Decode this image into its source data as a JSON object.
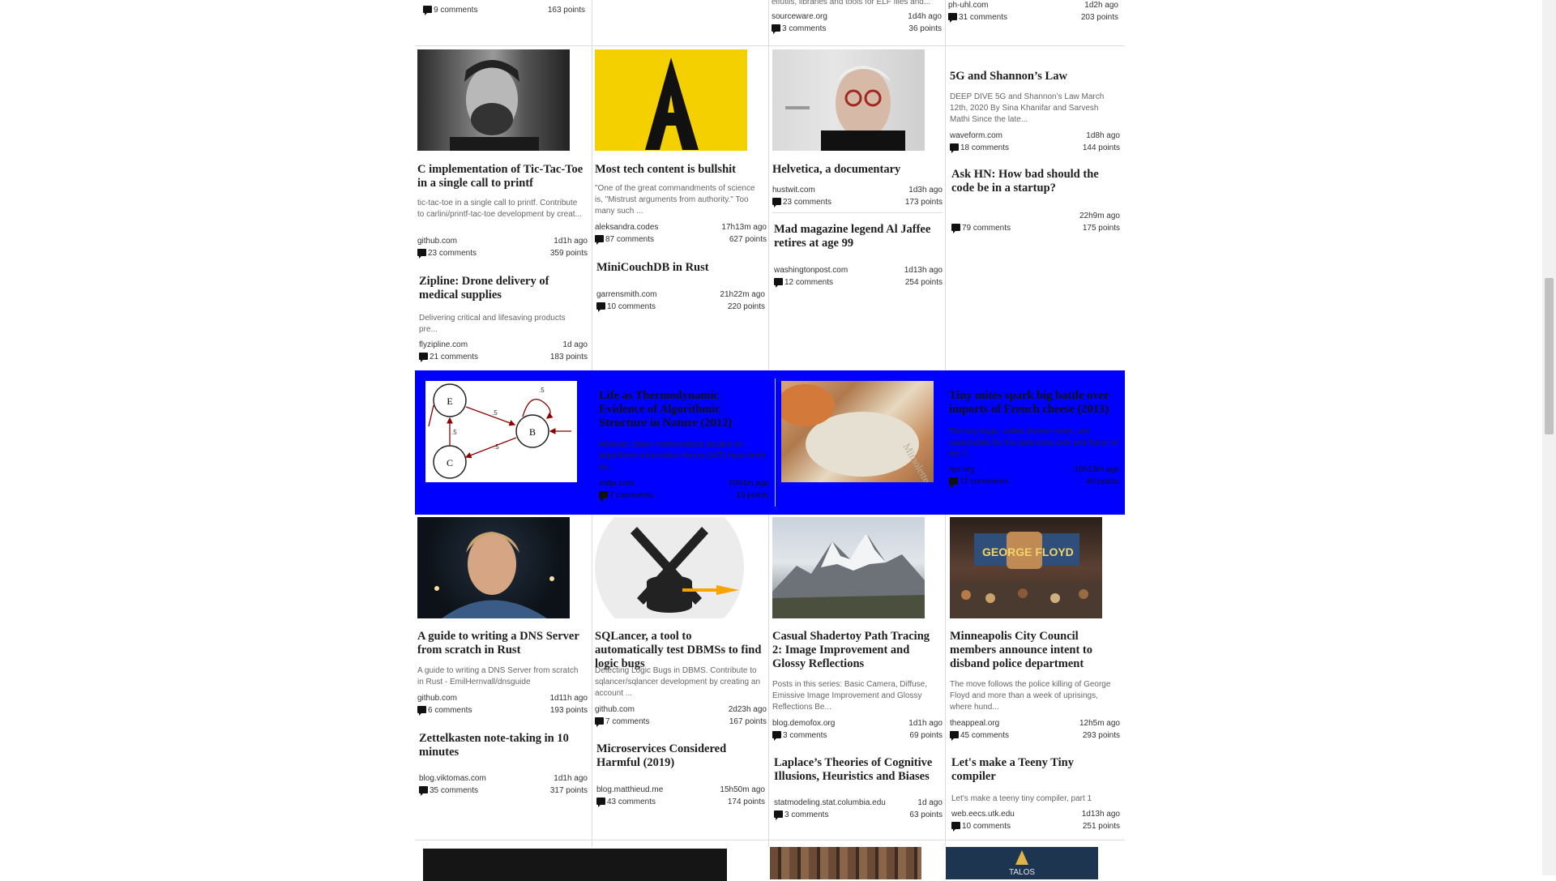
{
  "top_partial": {
    "col1": {
      "comments": "9 comments",
      "points": "163 points"
    },
    "col3": {
      "snippet": "elfutils, libraries and tools for ELF files and...",
      "domain": "sourceware.org",
      "age": "1d4h ago",
      "comments": "3 comments",
      "points": "36 points"
    },
    "col4": {
      "domain": "ph-uhl.com",
      "age": "1d2h ago",
      "comments": "31 comments",
      "points": "203 points"
    }
  },
  "articles": {
    "tictactoe": {
      "title": "C implementation of Tic-Tac-Toe in a single call to printf",
      "snippet": "tic-tac-toe in a single call to printf. Contribute to carlini/printf-tac-toe development by creat...",
      "domain": "github.com",
      "age": "1d1h ago",
      "comments": "23 comments",
      "points": "359 points"
    },
    "zipline": {
      "title": "Zipline: Drone delivery of medical supplies",
      "snippet": "Delivering critical and lifesaving products pre...",
      "domain": "flyzipline.com",
      "age": "1d ago",
      "comments": "21 comments",
      "points": "183 points"
    },
    "bullshit": {
      "title": "Most tech content is bullshit",
      "snippet": "\"One of the great commandments of science is, \"Mistrust arguments from authority.\" Too many such ...",
      "domain": "aleksandra.codes",
      "age": "17h13m ago",
      "comments": "87 comments",
      "points": "627 points"
    },
    "minicouch": {
      "title": "MiniCouchDB in Rust",
      "domain": "garrensmith.com",
      "age": "21h22m ago",
      "comments": "10 comments",
      "points": "220 points"
    },
    "helvetica": {
      "title": "Helvetica, a documentary",
      "domain": "hustwit.com",
      "age": "1d3h ago",
      "comments": "23 comments",
      "points": "173 points"
    },
    "jaffee": {
      "title": "Mad magazine legend Al Jaffee retires at age 99",
      "domain": "washingtonpost.com",
      "age": "1d13h ago",
      "comments": "12 comments",
      "points": "254 points"
    },
    "fiveg": {
      "title": "5G and Shannon’s Law",
      "snippet": "DEEP DIVE 5G and Shannon’s Law March 12th, 2020 By Sina Khanifar and Sarvesh Mathi Since the late...",
      "domain": "waveform.com",
      "age": "1d8h ago",
      "comments": "18 comments",
      "points": "144 points"
    },
    "askhn": {
      "title": "Ask HN: How bad should the code be in a startup?",
      "age": "22h9m ago",
      "comments": "79 comments",
      "points": "175 points"
    },
    "thermo": {
      "title": "Life as Thermodynamic Evidence of Algorithmic Structure in Nature (2012)",
      "snippet": "Abstract: Many mathematical studies on algorithmic information theory (AIT) have been on...",
      "domain": "mdpi.com",
      "age": "10h4m ago",
      "comments": "7 comments",
      "points": "19 points"
    },
    "cheese": {
      "title": "Tiny mites spark big battle over imports of French cheese (2013)",
      "snippet": "The tiny bugs, called cheese mites, are responsible for the distinctive look and flavor of the F...",
      "domain": "npr.org",
      "age": "10h13m ago",
      "comments": "12 comments",
      "points": "40 points"
    },
    "dns": {
      "title": "A guide to writing a DNS Server from scratch in Rust",
      "snippet": "A guide to writing a DNS Server from scratch in Rust - EmilHernvall/dnsguide",
      "domain": "github.com",
      "age": "1d11h ago",
      "comments": "6 comments",
      "points": "193 points"
    },
    "zettel": {
      "title": "Zettelkasten note-taking in 10 minutes",
      "domain": "blog.viktomas.com",
      "age": "1d1h ago",
      "comments": "35 comments",
      "points": "317 points"
    },
    "sqlancer": {
      "title": "SQLancer, a tool to automatically test DBMSs to find logic bugs",
      "snippet": "Detecting Logic Bugs in DBMS. Contribute to sqlancer/sqlancer development by creating an account ...",
      "domain": "github.com",
      "age": "2d23h ago",
      "comments": "7 comments",
      "points": "167 points"
    },
    "micro": {
      "title": "Microservices Considered Harmful (2019)",
      "domain": "blog.matthieud.me",
      "age": "15h50m ago",
      "comments": "43 comments",
      "points": "174 points"
    },
    "shadertoy": {
      "title": "Casual Shadertoy Path Tracing 2: Image Improvement and Glossy Reflections",
      "snippet": "Posts in this series: Basic Camera, Diffuse, Emissive Image Improvement and Glossy Reflections Be...",
      "domain": "blog.demofox.org",
      "age": "1d1h ago",
      "comments": "3 comments",
      "points": "69 points"
    },
    "laplace": {
      "title": "Laplace’s Theories of Cognitive Illusions, Heuristics and Biases",
      "domain": "statmodeling.stat.columbia.edu",
      "age": "1d ago",
      "comments": "3 comments",
      "points": "63 points"
    },
    "minneapolis": {
      "title": "Minneapolis City Council members announce intent to disband police department",
      "snippet": "The move follows the police killing of George Floyd and more than a week of uprisings, where hund...",
      "domain": "theappeal.org",
      "age": "12h5m ago",
      "comments": "45 comments",
      "points": "293 points"
    },
    "teeny": {
      "title": "Let's make a Teeny Tiny compiler",
      "snippet": "Let's make a teeny tiny compiler, part 1",
      "domain": "web.eecs.utk.edu",
      "age": "1d13h ago",
      "comments": "10 comments",
      "points": "251 points"
    }
  },
  "images": {
    "graph_nodes": [
      "E",
      "B",
      "C"
    ],
    "graph_edge_labels": [
      ".5",
      ".5",
      ".5",
      ".5"
    ],
    "sqlancer_logo": "windmill-database-logo",
    "bullshit_logo_letter": "A",
    "mural_text": "GEORGE FLOYD",
    "talos_text": "TALOS",
    "cheese_text": "Mimolette"
  },
  "colors": {
    "highlight_band": "#0000ff",
    "yellow_logo": "#f5d000"
  }
}
